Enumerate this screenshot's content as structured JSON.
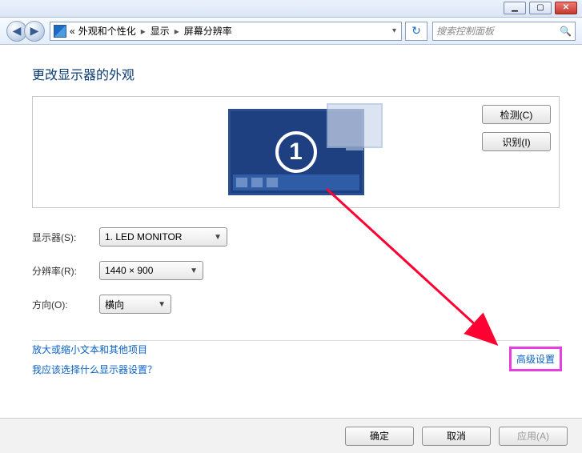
{
  "window": {
    "min_glyph": "▁",
    "max_glyph": "▢",
    "close_glyph": "✕"
  },
  "nav": {
    "back_glyph": "◀",
    "fwd_glyph": "▶",
    "refresh_glyph": "↻"
  },
  "breadcrumb": {
    "prefix": "«",
    "items": [
      "外观和个性化",
      "显示",
      "屏幕分辨率"
    ]
  },
  "search": {
    "placeholder": "搜索控制面板",
    "icon": "🔍"
  },
  "page": {
    "heading": "更改显示器的外观",
    "monitor_number": "1",
    "detect_btn": "检测(C)",
    "identify_btn": "识别(I)",
    "rows": {
      "display_label": "显示器(S):",
      "display_value": "1. LED MONITOR",
      "res_label": "分辨率(R):",
      "res_value": "1440 × 900",
      "orient_label": "方向(O):",
      "orient_value": "横向"
    },
    "advanced_link": "高级设置",
    "link1": "放大或缩小文本和其他项目",
    "link2": "我应该选择什么显示器设置？"
  },
  "footer": {
    "ok": "确定",
    "cancel": "取消",
    "apply": "应用(A)"
  }
}
